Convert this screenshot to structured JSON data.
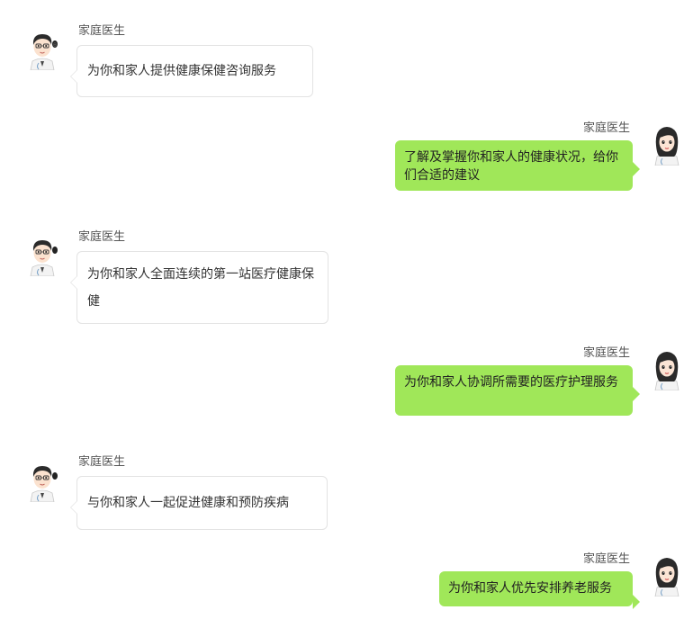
{
  "messages": [
    {
      "side": "left",
      "sender": "家庭医生",
      "text": "为你和家人提供健康保健咨询服务"
    },
    {
      "side": "right",
      "sender": "家庭医生",
      "text": "了解及掌握你和家人的健康状况，给你们合适的建议"
    },
    {
      "side": "left",
      "sender": "家庭医生",
      "text": "为你和家人全面连续的第一站医疗健康保健"
    },
    {
      "side": "right",
      "sender": "家庭医生",
      "text": "为你和家人协调所需要的医疗护理服务"
    },
    {
      "side": "left",
      "sender": "家庭医生",
      "text": "与你和家人一起促进健康和预防疾病"
    },
    {
      "side": "right",
      "sender": "家庭医生",
      "text": "为你和家人优先安排养老服务"
    }
  ],
  "avatars": {
    "left": "male-doctor-avatar",
    "right": "female-doctor-avatar"
  },
  "colors": {
    "right_bubble": "#a0e759",
    "left_bubble": "#ffffff",
    "left_bubble_border": "#e3e3e3"
  }
}
